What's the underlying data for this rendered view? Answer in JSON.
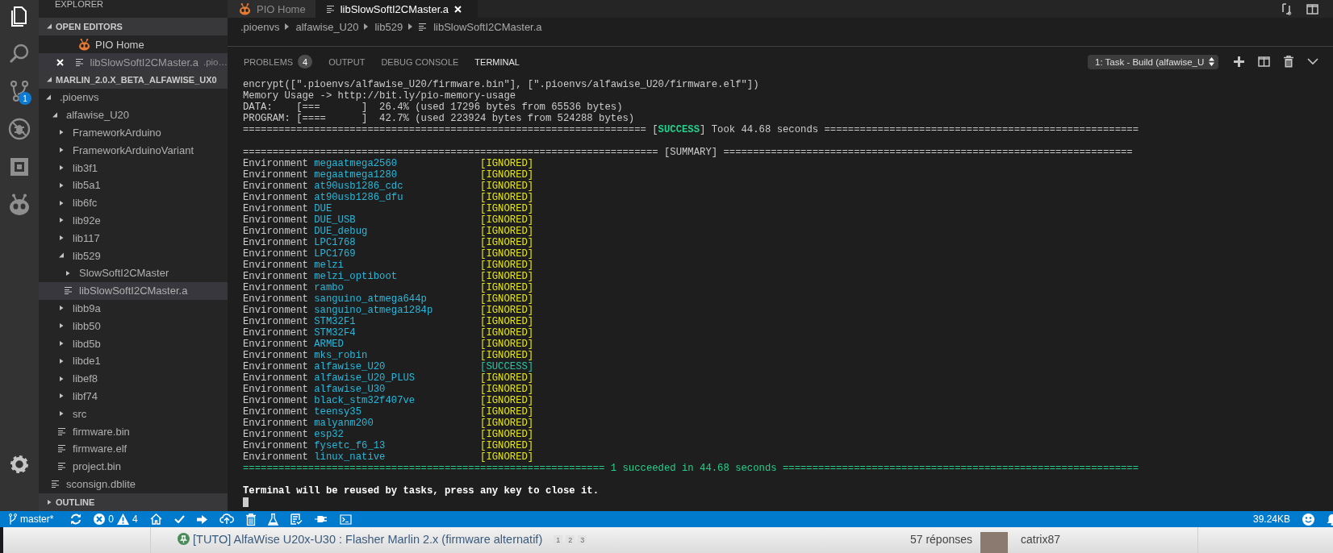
{
  "activity_bar": {
    "items": [
      {
        "kind": "files",
        "selected": true
      },
      {
        "kind": "search",
        "selected": false
      },
      {
        "kind": "source-control",
        "selected": false,
        "badge": "1"
      },
      {
        "kind": "debug",
        "selected": false
      },
      {
        "kind": "extensions",
        "selected": false
      },
      {
        "kind": "platformio",
        "selected": false
      }
    ]
  },
  "sidebar": {
    "title": "EXPLORER",
    "open_editors": {
      "title": "OPEN EDITORS",
      "expanded": true,
      "items": [
        {
          "label": "PIO Home",
          "kind": "pio",
          "selected": false
        },
        {
          "label": "libSlowSoftI2CMaster.a",
          "description": ".pio…",
          "kind": "file",
          "selected": true
        }
      ]
    },
    "folder": {
      "title": "MARLIN_2.0.X_BETA_ALFAWISE_UX0",
      "expanded": true,
      "tree": [
        {
          "label": ".pioenvs",
          "kind": "folder",
          "expanded": true,
          "selected": false,
          "children": [
            {
              "label": "alfawise_U20",
              "kind": "folder",
              "expanded": true,
              "selected": false,
              "children": [
                {
                  "label": "FrameworkArduino",
                  "kind": "folder",
                  "expanded": false,
                  "selected": false
                },
                {
                  "label": "FrameworkArduinoVariant",
                  "kind": "folder",
                  "expanded": false,
                  "selected": false
                },
                {
                  "label": "lib3f1",
                  "kind": "folder",
                  "expanded": false,
                  "selected": false
                },
                {
                  "label": "lib5a1",
                  "kind": "folder",
                  "expanded": false,
                  "selected": false
                },
                {
                  "label": "lib6fc",
                  "kind": "folder",
                  "expanded": false,
                  "selected": false
                },
                {
                  "label": "lib92e",
                  "kind": "folder",
                  "expanded": false,
                  "selected": false
                },
                {
                  "label": "lib117",
                  "kind": "folder",
                  "expanded": false,
                  "selected": false
                },
                {
                  "label": "lib529",
                  "kind": "folder",
                  "expanded": true,
                  "selected": false,
                  "children": [
                    {
                      "label": "SlowSoftI2CMaster",
                      "kind": "folder",
                      "expanded": false,
                      "selected": false
                    },
                    {
                      "label": "libSlowSoftI2CMaster.a",
                      "kind": "file",
                      "selected": true
                    }
                  ]
                },
                {
                  "label": "libb9a",
                  "kind": "folder",
                  "expanded": false,
                  "selected": false
                },
                {
                  "label": "libb50",
                  "kind": "folder",
                  "expanded": false,
                  "selected": false
                },
                {
                  "label": "libd5b",
                  "kind": "folder",
                  "expanded": false,
                  "selected": false
                },
                {
                  "label": "libde1",
                  "kind": "folder",
                  "expanded": false,
                  "selected": false
                },
                {
                  "label": "libef8",
                  "kind": "folder",
                  "expanded": false,
                  "selected": false
                },
                {
                  "label": "libf74",
                  "kind": "folder",
                  "expanded": false,
                  "selected": false
                },
                {
                  "label": "src",
                  "kind": "folder",
                  "expanded": false,
                  "selected": false
                },
                {
                  "label": "firmware.bin",
                  "kind": "file",
                  "selected": false
                },
                {
                  "label": "firmware.elf",
                  "kind": "file",
                  "selected": false
                },
                {
                  "label": "project.bin",
                  "kind": "file",
                  "selected": false
                }
              ]
            },
            {
              "label": "sconsign.dblite",
              "kind": "file",
              "selected": false
            }
          ]
        }
      ]
    },
    "outline": {
      "title": "OUTLINE",
      "expanded": false
    }
  },
  "editor": {
    "tabs": [
      {
        "label": "PIO Home",
        "kind": "pio",
        "selected": false
      },
      {
        "label": "libSlowSoftI2CMaster.a",
        "kind": "file",
        "selected": true
      }
    ],
    "breadcrumbs": [
      {
        "label": ".pioenvs",
        "kind": "folder"
      },
      {
        "label": "alfawise_U20",
        "kind": "folder"
      },
      {
        "label": "lib529",
        "kind": "folder"
      },
      {
        "label": "libSlowSoftI2CMaster.a",
        "kind": "file"
      }
    ]
  },
  "panel": {
    "tabs": [
      {
        "label": "PROBLEMS",
        "badge": "4",
        "selected": false
      },
      {
        "label": "OUTPUT",
        "selected": false
      },
      {
        "label": "DEBUG CONSOLE",
        "selected": false
      },
      {
        "label": "TERMINAL",
        "selected": true
      }
    ],
    "terminal_select": "1: Task - Build (alfawise_U",
    "terminal": {
      "lines": [
        {
          "kind": "text",
          "segments": [
            {
              "text": "encrypt([\".pioenvs/alfawise_U20/firmware.bin\"], [\".pioenvs/alfawise_U20/firmware.elf\"])",
              "kind": "plain"
            }
          ]
        },
        {
          "kind": "text",
          "segments": [
            {
              "text": "Memory Usage -> http://bit.ly/pio-memory-usage",
              "kind": "plain"
            }
          ]
        },
        {
          "kind": "text",
          "segments": [
            {
              "text": "DATA:    [===       ]  26.4% (used 17296 bytes from 65536 bytes)",
              "kind": "plain"
            }
          ]
        },
        {
          "kind": "text",
          "segments": [
            {
              "text": "PROGRAM: [====      ]  42.7% (used 223924 bytes from 524288 bytes)",
              "kind": "plain"
            }
          ]
        },
        {
          "kind": "text",
          "segments": [
            {
              "text": "==================================================================== [",
              "kind": "plain"
            },
            {
              "text": "SUCCESS",
              "kind": "success"
            },
            {
              "text": "] Took 44.68 seconds =====================================================",
              "kind": "plain"
            }
          ]
        },
        {
          "kind": "blank"
        },
        {
          "kind": "text",
          "segments": [
            {
              "text": "====================================================================== [SUMMARY] =====================================================================",
              "kind": "plain"
            }
          ]
        },
        {
          "kind": "env",
          "label": "Environment",
          "name": "megaatmega2560",
          "status": "[IGNORED]",
          "succeeded": false
        },
        {
          "kind": "env",
          "label": "Environment",
          "name": "megaatmega1280",
          "status": "[IGNORED]",
          "succeeded": false
        },
        {
          "kind": "env",
          "label": "Environment",
          "name": "at90usb1286_cdc",
          "status": "[IGNORED]",
          "succeeded": false
        },
        {
          "kind": "env",
          "label": "Environment",
          "name": "at90usb1286_dfu",
          "status": "[IGNORED]",
          "succeeded": false
        },
        {
          "kind": "env",
          "label": "Environment",
          "name": "DUE",
          "status": "[IGNORED]",
          "succeeded": false
        },
        {
          "kind": "env",
          "label": "Environment",
          "name": "DUE_USB",
          "status": "[IGNORED]",
          "succeeded": false
        },
        {
          "kind": "env",
          "label": "Environment",
          "name": "DUE_debug",
          "status": "[IGNORED]",
          "succeeded": false
        },
        {
          "kind": "env",
          "label": "Environment",
          "name": "LPC1768",
          "status": "[IGNORED]",
          "succeeded": false
        },
        {
          "kind": "env",
          "label": "Environment",
          "name": "LPC1769",
          "status": "[IGNORED]",
          "succeeded": false
        },
        {
          "kind": "env",
          "label": "Environment",
          "name": "melzi",
          "status": "[IGNORED]",
          "succeeded": false
        },
        {
          "kind": "env",
          "label": "Environment",
          "name": "melzi_optiboot",
          "status": "[IGNORED]",
          "succeeded": false
        },
        {
          "kind": "env",
          "label": "Environment",
          "name": "rambo",
          "status": "[IGNORED]",
          "succeeded": false
        },
        {
          "kind": "env",
          "label": "Environment",
          "name": "sanguino_atmega644p",
          "status": "[IGNORED]",
          "succeeded": false
        },
        {
          "kind": "env",
          "label": "Environment",
          "name": "sanguino_atmega1284p",
          "status": "[IGNORED]",
          "succeeded": false
        },
        {
          "kind": "env",
          "label": "Environment",
          "name": "STM32F1",
          "status": "[IGNORED]",
          "succeeded": false
        },
        {
          "kind": "env",
          "label": "Environment",
          "name": "STM32F4",
          "status": "[IGNORED]",
          "succeeded": false
        },
        {
          "kind": "env",
          "label": "Environment",
          "name": "ARMED",
          "status": "[IGNORED]",
          "succeeded": false
        },
        {
          "kind": "env",
          "label": "Environment",
          "name": "mks_robin",
          "status": "[IGNORED]",
          "succeeded": false
        },
        {
          "kind": "env",
          "label": "Environment",
          "name": "alfawise_U20",
          "status": "[SUCCESS]",
          "succeeded": true
        },
        {
          "kind": "env",
          "label": "Environment",
          "name": "alfawise_U20_PLUS",
          "status": "[IGNORED]",
          "succeeded": false
        },
        {
          "kind": "env",
          "label": "Environment",
          "name": "alfawise_U30",
          "status": "[IGNORED]",
          "succeeded": false
        },
        {
          "kind": "env",
          "label": "Environment",
          "name": "black_stm32f407ve",
          "status": "[IGNORED]",
          "succeeded": false
        },
        {
          "kind": "env",
          "label": "Environment",
          "name": "teensy35",
          "status": "[IGNORED]",
          "succeeded": false
        },
        {
          "kind": "env",
          "label": "Environment",
          "name": "malyanm200",
          "status": "[IGNORED]",
          "succeeded": false
        },
        {
          "kind": "env",
          "label": "Environment",
          "name": "esp32",
          "status": "[IGNORED]",
          "succeeded": false
        },
        {
          "kind": "env",
          "label": "Environment",
          "name": "fysetc_f6_13",
          "status": "[IGNORED]",
          "succeeded": false
        },
        {
          "kind": "env",
          "label": "Environment",
          "name": "linux_native",
          "status": "[IGNORED]",
          "succeeded": false
        },
        {
          "kind": "text",
          "segments": [
            {
              "text": "============================================================= 1 succeeded in 44.68 seconds ============================================================",
              "kind": "green"
            }
          ]
        },
        {
          "kind": "blank"
        },
        {
          "kind": "text",
          "segments": [
            {
              "text": "Terminal will be reused by tasks, press any key to close it.",
              "kind": "bold"
            }
          ]
        },
        {
          "kind": "cursor"
        }
      ]
    }
  },
  "status_bar": {
    "branch": "master*",
    "errors": "0",
    "warnings": "4",
    "size": "39.24KB"
  },
  "forum": {
    "title": "[TUTO] AlfaWise U20x-U30 : Flasher Marlin 2.x (firmware alternatif)",
    "pages": [
      "1",
      "2",
      "3"
    ],
    "replies": "57 réponses",
    "author": "catrix87"
  }
}
